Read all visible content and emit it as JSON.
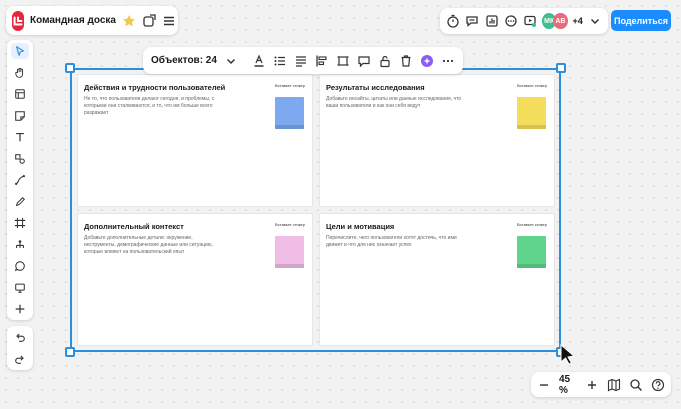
{
  "board": {
    "title": "Командная доска",
    "brand_color": "#e8253a"
  },
  "collab": {
    "avatars": [
      {
        "initials": "МК",
        "color": "#3fbf8f"
      },
      {
        "initials": "АВ",
        "color": "#e96a7b"
      }
    ],
    "more_count": "+4",
    "share_label": "Поделиться",
    "share_color": "#1a8cff"
  },
  "context_toolbar": {
    "objects_label": "Объектов: 24"
  },
  "cards": [
    {
      "title": "Действия и трудности пользователей",
      "description": "Не то, что пользователи делают сегодня, и проблемы, с которыми они сталкиваются, и то, что им больше всего разражает",
      "sticker_label": "Вставьте стикер",
      "sticky_color": "#7da9f0"
    },
    {
      "title": "Результаты исследования",
      "description": "Добавьте инсайты, цитаты или данные исследования, что ваши пользователи и как они себя ведут",
      "sticker_label": "Вставьте стикер",
      "sticky_color": "#f5dd5c"
    },
    {
      "title": "Дополнительный контекст",
      "description": "Добавьте дополнительные детали: окружение, инструменты, демографические данные или ситуацию, которые влияют на пользовательский опыт",
      "sticker_label": "Вставьте стикер",
      "sticky_color": "#f0bde6"
    },
    {
      "title": "Цели и мотивация",
      "description": "Перечислите, чего пользователи хотят достичь, что ими движет и что для них означает успех",
      "sticker_label": "Вставьте стикер",
      "sticky_color": "#5fd48a"
    }
  ],
  "zoom": {
    "value": "45 %"
  },
  "selection_color": "#2b8fe0"
}
